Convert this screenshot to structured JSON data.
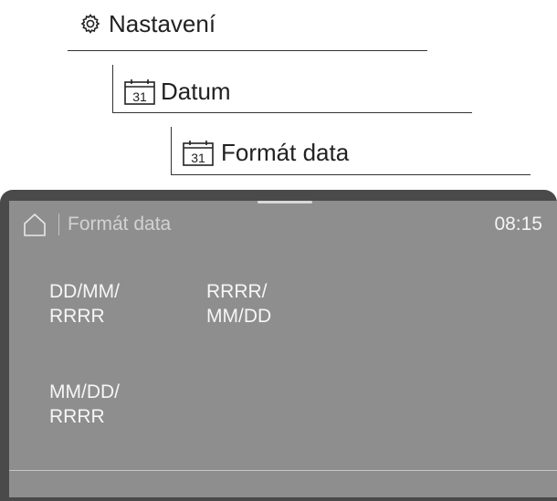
{
  "breadcrumbs": [
    {
      "label": "Nastavení",
      "icon": "gear-icon"
    },
    {
      "label": "Datum",
      "icon": "calendar-icon",
      "icon_text": "31"
    },
    {
      "label": "Formát data",
      "icon": "calendar-icon",
      "icon_text": "31"
    }
  ],
  "screen": {
    "title": "Formát data",
    "time": "08:15",
    "home_icon": "home-icon",
    "options": [
      {
        "label": "DD/MM/\nRRRR"
      },
      {
        "label": "RRRR/\nMM/DD"
      },
      {
        "label": "MM/DD/\nRRRR"
      }
    ]
  },
  "colors": {
    "bezel": "#4a4a4a",
    "panel": "#8e8e8e",
    "text_on_panel": "#f6f6f6"
  }
}
